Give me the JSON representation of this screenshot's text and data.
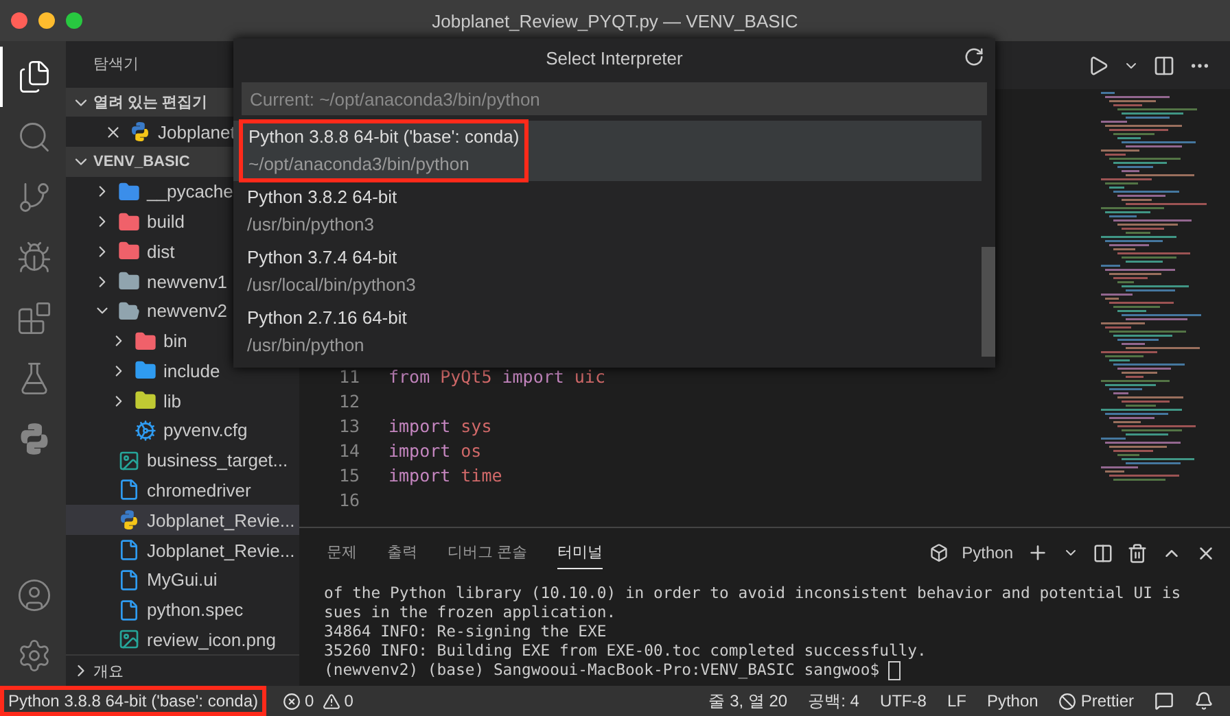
{
  "window": {
    "title": "Jobplanet_Review_PYQT.py — VENV_BASIC"
  },
  "activity_bar": {
    "items": [
      {
        "kind": "files",
        "selected": true
      },
      {
        "kind": "search",
        "selected": false
      },
      {
        "kind": "branch",
        "selected": false
      },
      {
        "kind": "debug",
        "selected": false
      },
      {
        "kind": "extensions",
        "selected": false
      },
      {
        "kind": "flask",
        "selected": false
      },
      {
        "kind": "python",
        "selected": false
      }
    ],
    "bottom": [
      {
        "kind": "account"
      },
      {
        "kind": "gear"
      }
    ]
  },
  "sidebar": {
    "title": "탐색기",
    "open_editors": {
      "label": "열려 있는 편집기",
      "expanded": true,
      "items": [
        {
          "name": "Jobplanet",
          "kind": "python"
        }
      ]
    },
    "project": {
      "label": "VENV_BASIC",
      "expanded": true,
      "items": [
        {
          "name": "__pycache",
          "kind": "folder",
          "color": "#3b8eea",
          "expanded": false,
          "selected": false
        },
        {
          "name": "build",
          "kind": "folder",
          "color": "#f0616a",
          "expanded": false,
          "selected": false
        },
        {
          "name": "dist",
          "kind": "folder",
          "color": "#f0616a",
          "expanded": false,
          "selected": false
        },
        {
          "name": "newvenv1",
          "kind": "folder",
          "color": "#90a4ae",
          "expanded": false,
          "selected": false
        },
        {
          "name": "newvenv2",
          "kind": "folder",
          "color": "#90a4ae",
          "expanded": true,
          "selected": false,
          "children": [
            {
              "name": "bin",
              "kind": "folder",
              "color": "#f0616a",
              "expanded": false,
              "selected": false
            },
            {
              "name": "include",
              "kind": "folder",
              "color": "#2f9bf0",
              "expanded": false,
              "selected": false
            },
            {
              "name": "lib",
              "kind": "folder",
              "color": "#c0ca33",
              "expanded": false,
              "selected": false
            },
            {
              "name": "pyvenv.cfg",
              "kind": "gear",
              "selected": false
            }
          ]
        },
        {
          "name": "business_target...",
          "kind": "image",
          "selected": false
        },
        {
          "name": "chromedriver",
          "kind": "file",
          "selected": false
        },
        {
          "name": "Jobplanet_Revie...",
          "kind": "python",
          "selected": true
        },
        {
          "name": "Jobplanet_Revie...",
          "kind": "file",
          "selected": false
        },
        {
          "name": "MyGui.ui",
          "kind": "file",
          "selected": false
        },
        {
          "name": "python.spec",
          "kind": "file",
          "selected": false
        },
        {
          "name": "review_icon.png",
          "kind": "image",
          "selected": false
        }
      ]
    },
    "outline": {
      "label": "개요",
      "expanded": false
    }
  },
  "editor": {
    "code": [
      {
        "number": "11",
        "tokens": [
          {
            "text": "from",
            "kind": "keyword"
          },
          {
            "text": "PyQt5",
            "kind": "module"
          },
          {
            "text": "import",
            "kind": "keyword"
          },
          {
            "text": "uic",
            "kind": "module"
          }
        ]
      },
      {
        "number": "12"
      },
      {
        "number": "13",
        "tokens": [
          {
            "text": "import",
            "kind": "keyword"
          },
          {
            "text": "sys",
            "kind": "module"
          }
        ]
      },
      {
        "number": "14",
        "tokens": [
          {
            "text": "import",
            "kind": "keyword"
          },
          {
            "text": "os",
            "kind": "module"
          }
        ]
      },
      {
        "number": "15",
        "tokens": [
          {
            "text": "import",
            "kind": "keyword"
          },
          {
            "text": "time",
            "kind": "module"
          }
        ]
      },
      {
        "number": "16"
      }
    ]
  },
  "quick_pick": {
    "title": "Select Interpreter",
    "input": {
      "placeholder": "Current: ~/opt/anaconda3/bin/python"
    },
    "items": [
      {
        "label": "Python 3.8.8 64-bit ('base': conda)",
        "path": "~/opt/anaconda3/bin/python",
        "selected": true,
        "highlighted": true
      },
      {
        "label": "Python 3.8.2 64-bit",
        "path": "/usr/bin/python3",
        "selected": false,
        "highlighted": false
      },
      {
        "label": "Python 3.7.4 64-bit",
        "path": "/usr/local/bin/python3",
        "selected": false,
        "highlighted": false
      },
      {
        "label": "Python 2.7.16 64-bit",
        "path": "/usr/bin/python",
        "selected": false,
        "highlighted": false
      }
    ]
  },
  "panel": {
    "tabs": [
      {
        "label": "문제",
        "selected": false
      },
      {
        "label": "출력",
        "selected": false
      },
      {
        "label": "디버그 콘솔",
        "selected": false
      },
      {
        "label": "터미널",
        "selected": true
      }
    ],
    "terminal_name": "Python",
    "terminal": [
      "of the Python library (10.10.0) in order to avoid inconsistent behavior and potential UI is",
      "sues in the frozen application.",
      "34864 INFO: Re-signing the EXE",
      "35260 INFO: Building EXE from EXE-00.toc completed successfully.",
      "(newvenv2) (base) Sangwooui-MacBook-Pro:VENV_BASIC sangwoo$ "
    ]
  },
  "status_bar": {
    "interpreter": {
      "label": "Python 3.8.8 64-bit ('base': conda)",
      "highlighted": true
    },
    "errors": "0",
    "warnings": "0",
    "right": [
      {
        "label": "줄 3, 열 20",
        "kind": "text"
      },
      {
        "label": "공백: 4",
        "kind": "text"
      },
      {
        "label": "UTF-8",
        "kind": "text"
      },
      {
        "label": "LF",
        "kind": "text"
      },
      {
        "label": "Python",
        "kind": "text"
      },
      {
        "label": "Prettier",
        "kind": "prettier"
      }
    ]
  }
}
